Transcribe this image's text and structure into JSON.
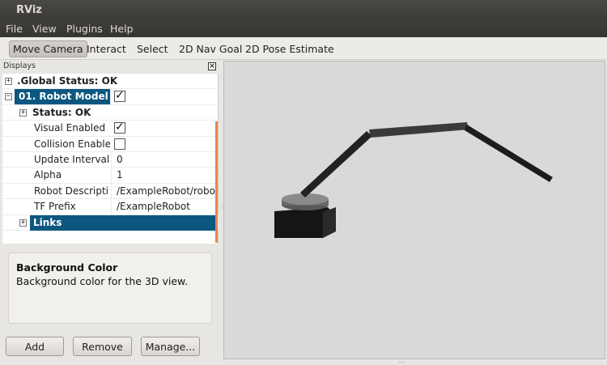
{
  "window": {
    "title": "RViz"
  },
  "menu": [
    "File",
    "View",
    "Plugins",
    "Help"
  ],
  "toolbar": [
    "Move Camera",
    "Interact",
    "Select",
    "2D Nav Goal",
    "2D Pose Estimate"
  ],
  "displays_panel": {
    "title": "Displays",
    "rows": {
      "global_status": ".Global Status: OK",
      "robot_model": "01. Robot Model (",
      "status": "Status: OK",
      "visual_enabled": "Visual Enabled",
      "collision_enabled": "Collision Enable",
      "update_interval": "Update Interval",
      "update_interval_value": "0",
      "alpha": "Alpha",
      "alpha_value": "1",
      "robot_description": "Robot Descripti",
      "robot_description_value": "/ExampleRobot/robo",
      "tf_prefix": "TF Prefix",
      "tf_prefix_value": "/ExampleRobot",
      "links": "Links"
    },
    "checks": {
      "robot_model": true,
      "visual_enabled": true,
      "collision_enabled": false
    }
  },
  "description": {
    "title": "Background Color",
    "text": "Background color for the 3D view."
  },
  "buttons": {
    "add": "Add",
    "remove": "Remove",
    "manage": "Manage..."
  },
  "colors": {
    "selection": "#0c5780",
    "viewport_bg": "#d9d9d9",
    "accent": "#e5864f"
  }
}
